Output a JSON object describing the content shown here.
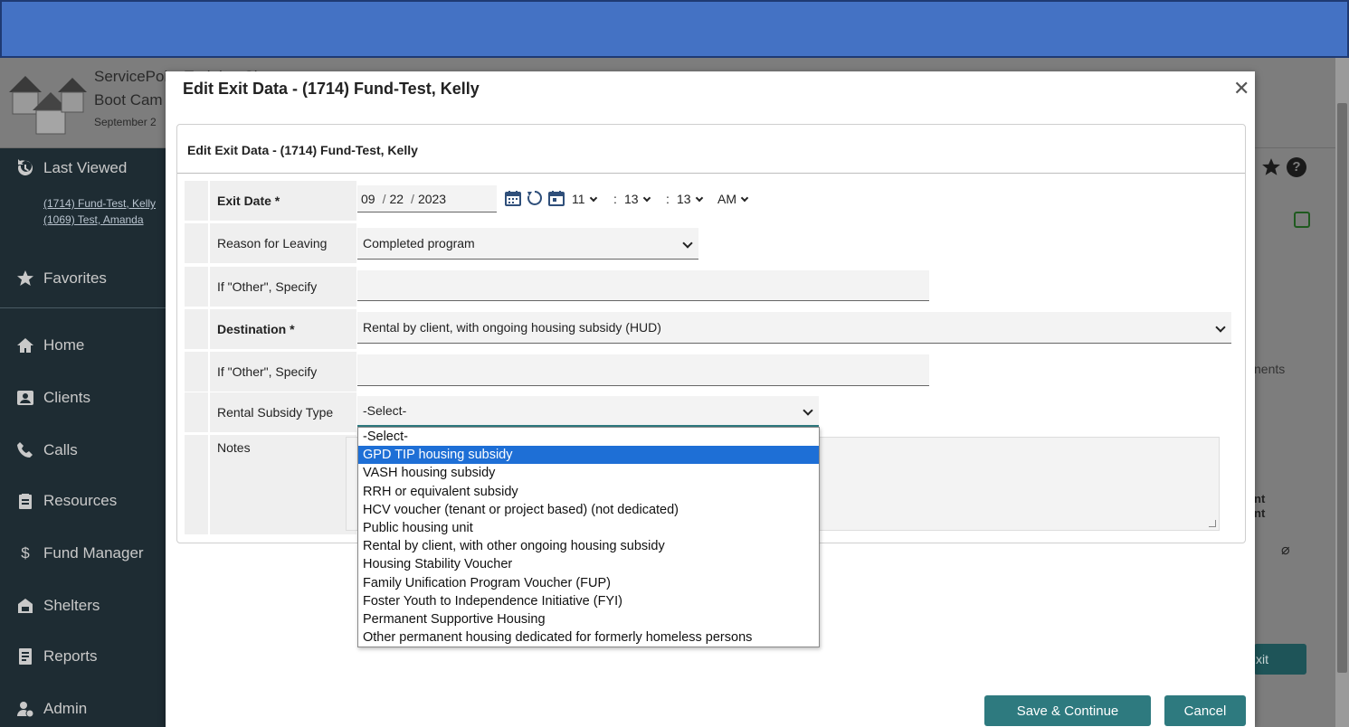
{
  "brand": {
    "site_name": "ServicePoint Training Site",
    "subtitle": "Boot Cam",
    "date_partial": "September 2"
  },
  "sidebar": {
    "last_viewed_label": "Last Viewed",
    "recent": [
      "(1714) Fund-Test, Kelly",
      "(1069) Test, Amanda"
    ],
    "items": [
      {
        "label": "Favorites",
        "icon": "star-icon"
      },
      {
        "label": "Home",
        "icon": "home-icon"
      },
      {
        "label": "Clients",
        "icon": "clients-icon"
      },
      {
        "label": "Calls",
        "icon": "phone-icon"
      },
      {
        "label": "Resources",
        "icon": "clipboard-icon"
      },
      {
        "label": "Fund Manager",
        "icon": "dollar-icon"
      },
      {
        "label": "Shelters",
        "icon": "shelter-icon"
      },
      {
        "label": "Reports",
        "icon": "report-icon"
      },
      {
        "label": "Admin",
        "icon": "admin-icon"
      }
    ]
  },
  "background_right": {
    "tab_partial": "nents",
    "col_partial1": "nt",
    "col_partial2": "nt",
    "button_partial": "xit"
  },
  "modal": {
    "title": "Edit Exit Data - (1714) Fund-Test, Kelly",
    "panel_title": "Edit Exit Data - (1714) Fund-Test, Kelly",
    "fields": {
      "exit_date_label": "Exit Date *",
      "month": "09",
      "day": "22",
      "year": "2023",
      "sep": "/",
      "hour": "11",
      "minute": "13",
      "second": "13",
      "ampm": "AM",
      "colon": ":",
      "reason_label": "Reason for Leaving",
      "reason_value": "Completed program",
      "other1_label": "If \"Other\", Specify",
      "destination_label": "Destination *",
      "destination_value": "Rental by client, with ongoing housing subsidy (HUD)",
      "other2_label": "If \"Other\", Specify",
      "subsidy_label": "Rental Subsidy Type",
      "subsidy_value": "-Select-",
      "notes_label": "Notes"
    },
    "subsidy_options": [
      "-Select-",
      "GPD TIP housing subsidy",
      "VASH housing subsidy",
      "RRH or equivalent subsidy",
      "HCV voucher (tenant or project based) (not dedicated)",
      "Public housing unit",
      "Rental by client, with other ongoing housing subsidy",
      "Housing Stability Voucher",
      "Family Unification Program Voucher (FUP)",
      "Foster Youth to Independence Initiative (FYI)",
      "Permanent Supportive Housing",
      "Other permanent housing dedicated for formerly homeless persons"
    ],
    "highlighted_option": "GPD TIP housing subsidy",
    "save_label": "Save & Continue",
    "cancel_label": "Cancel"
  },
  "colors": {
    "topbar": "#4472c4",
    "sidebar": "#1e2c33",
    "button": "#2e7a7f",
    "highlight": "#1e6fd6"
  }
}
